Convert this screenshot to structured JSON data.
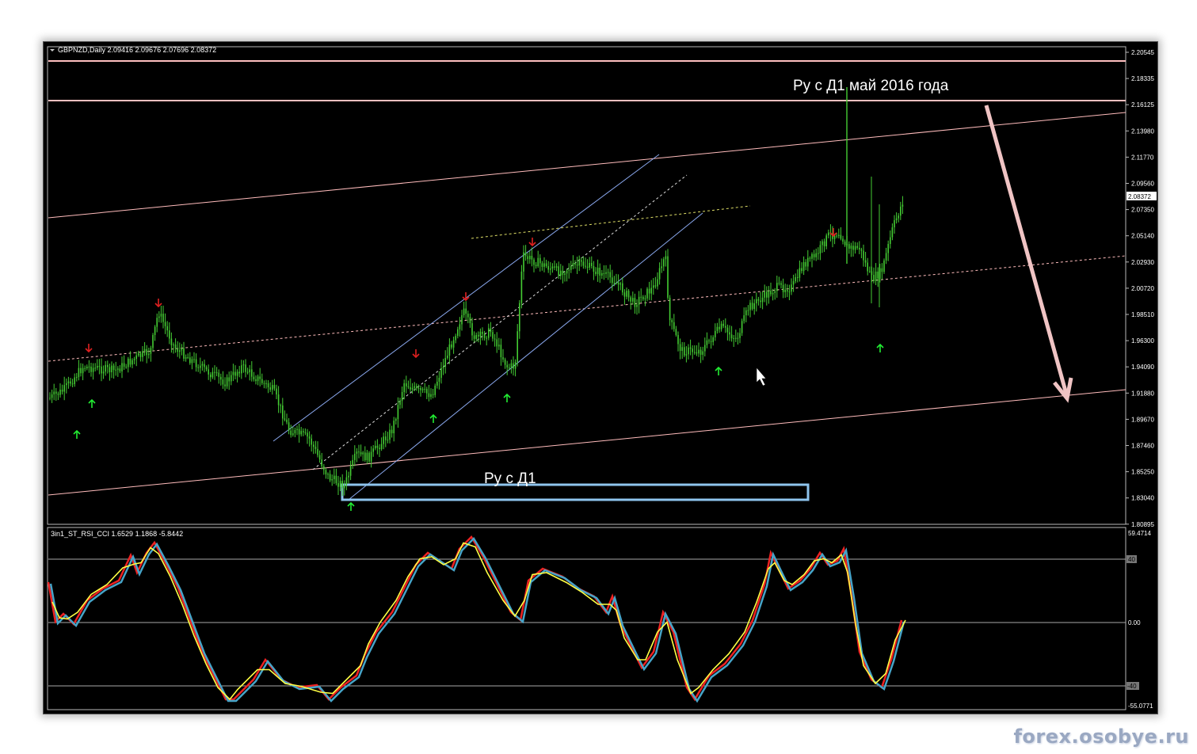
{
  "main_pane": {
    "header": "GBPNZD,Daily  2.09416 2.09676 2.07696 2.08372",
    "current_price": "2.08372",
    "price_ticks": [
      "2.20545",
      "2.18335",
      "2.16125",
      "2.13980",
      "2.11770",
      "2.09560",
      "2.07350",
      "2.05140",
      "2.02930",
      "2.00720",
      "1.98510",
      "1.96300",
      "1.94090",
      "1.91880",
      "1.89670",
      "1.87460",
      "1.85250",
      "1.83040",
      "1.80895"
    ],
    "annotation_top": "Ру с Д1 май 2016 года",
    "annotation_bottom": "Ру с Д1",
    "colors": {
      "candle": "#44cc33",
      "level": "#ffc0c0",
      "arrow_up": "#22ee33",
      "arrow_down": "#e02020",
      "annotation_box": "#8ec4ee"
    }
  },
  "sub_pane": {
    "header": "3in1_ST_RSI_CCI 1.6529 1.1868 -5.8442",
    "scale_ticks": [
      "59.4714",
      "40",
      "0.00",
      "-40",
      "-55.0771"
    ],
    "colors": {
      "line_red": "#ee2222",
      "line_blue": "#46a4c8",
      "line_yellow": "#ffff44"
    }
  },
  "watermark": "forex.osobye.ru"
}
